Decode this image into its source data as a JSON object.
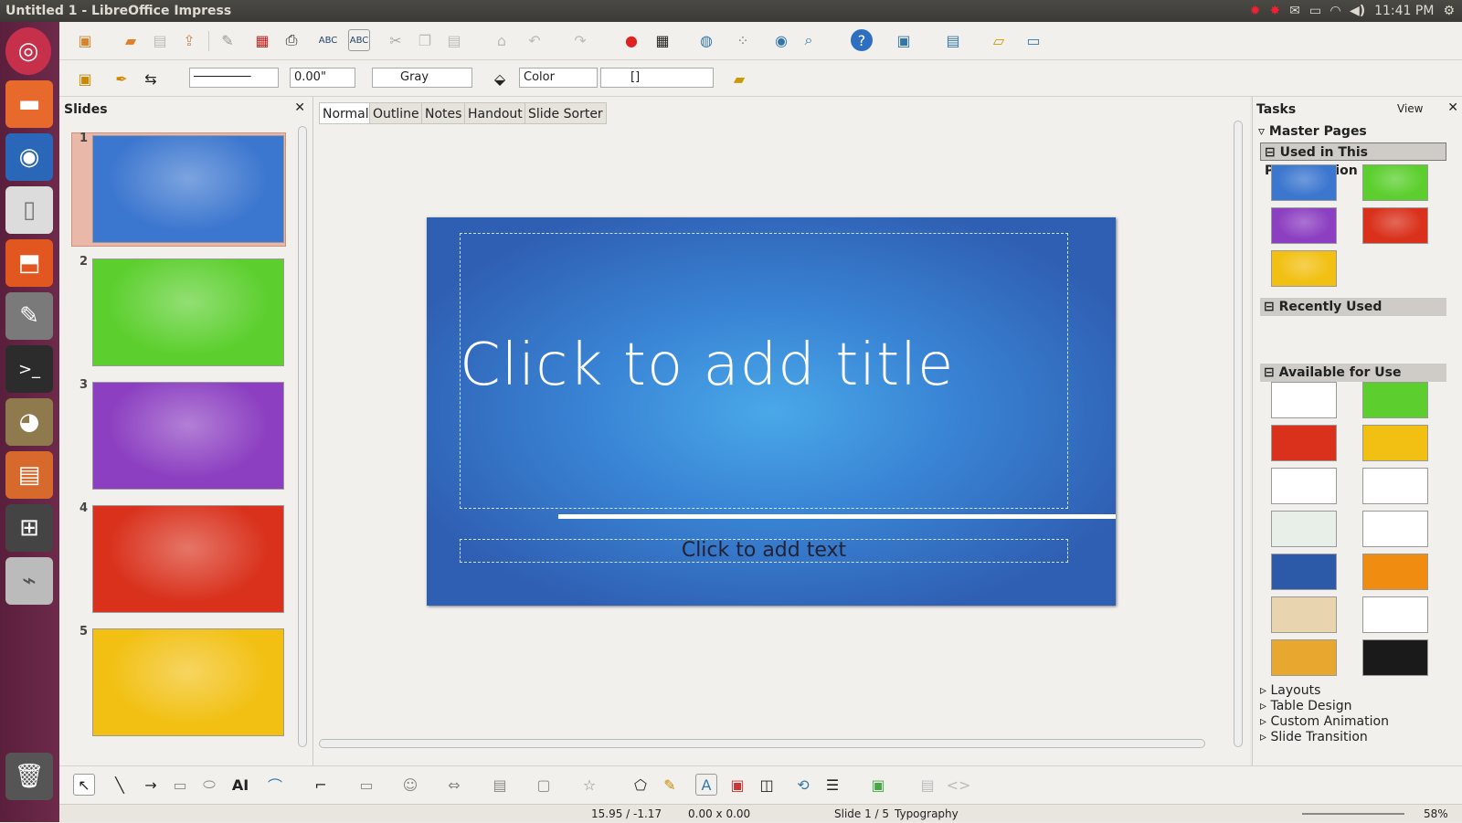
{
  "window_title": "Untitled 1 - LibreOffice Impress",
  "system": {
    "time": "11:41 PM"
  },
  "toolbar2": {
    "line_width": "0.00\"",
    "line_color": "Gray",
    "area_style": "Color",
    "area_color": "[]"
  },
  "view_tabs": [
    "Normal",
    "Outline",
    "Notes",
    "Handout",
    "Slide Sorter"
  ],
  "slides_panel": {
    "title": "Slides",
    "slides": [
      {
        "num": "1",
        "color": "#3b76cf"
      },
      {
        "num": "2",
        "color": "#5ccf2e"
      },
      {
        "num": "3",
        "color": "#8c3fc1"
      },
      {
        "num": "4",
        "color": "#d9311c"
      },
      {
        "num": "5",
        "color": "#f2c012"
      }
    ]
  },
  "slide": {
    "title_placeholder": "Click to add title",
    "text_placeholder": "Click to add text"
  },
  "tasks": {
    "title": "Tasks",
    "view_label": "View",
    "master_pages_label": "Master Pages",
    "used_label": "Used in This Presentation",
    "recent_label": "Recently Used",
    "available_label": "Available for Use",
    "collapsed": [
      "Layouts",
      "Table Design",
      "Custom Animation",
      "Slide Transition"
    ],
    "used_colors": [
      "#3b76cf",
      "#5ccf2e",
      "#8c3fc1",
      "#d9311c",
      "#f2c012"
    ],
    "available_colors": [
      "#ffffff",
      "#5ccf2e",
      "#d9311c",
      "#f2c012",
      "#ffffff",
      "#ffffff",
      "#e8efe8",
      "#ffffff",
      "#2c5aa8",
      "#f08c10",
      "#e9d4b0",
      "#ffffff",
      "#e8a830",
      "#1a1a1a"
    ]
  },
  "status": {
    "position": "15.95 / -1.17",
    "size": "0.00 x 0.00",
    "slide": "Slide 1 / 5",
    "master": "Typography",
    "zoom": "58%"
  }
}
